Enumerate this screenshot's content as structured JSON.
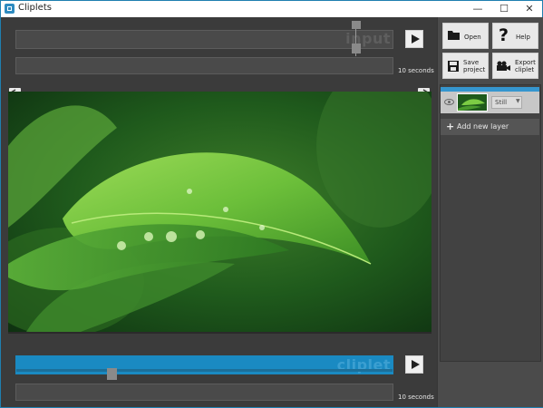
{
  "window": {
    "title": "Cliplets",
    "controls": {
      "minimize": "—",
      "maximize": "☐",
      "close": "✕"
    }
  },
  "input_timeline": {
    "track_label": "input",
    "duration_label": "10 seconds",
    "play_icon": "play-icon"
  },
  "output_timeline": {
    "track_label": "cliplet",
    "duration_label": "10 seconds",
    "play_icon": "play-icon"
  },
  "toolbar": {
    "open_label": "Open",
    "help_label": "Help",
    "save_label_1": "Save",
    "save_label_2": "project",
    "export_label_1": "Export",
    "export_label_2": "cliplet"
  },
  "layers": {
    "items": [
      {
        "mode": "Still",
        "thumbnail": "green leaf with water droplets"
      }
    ],
    "add_label": "Add new layer"
  },
  "colors": {
    "accent": "#1a8ac2",
    "panel_bg": "#474747",
    "track_bg": "#4a4a4a"
  }
}
